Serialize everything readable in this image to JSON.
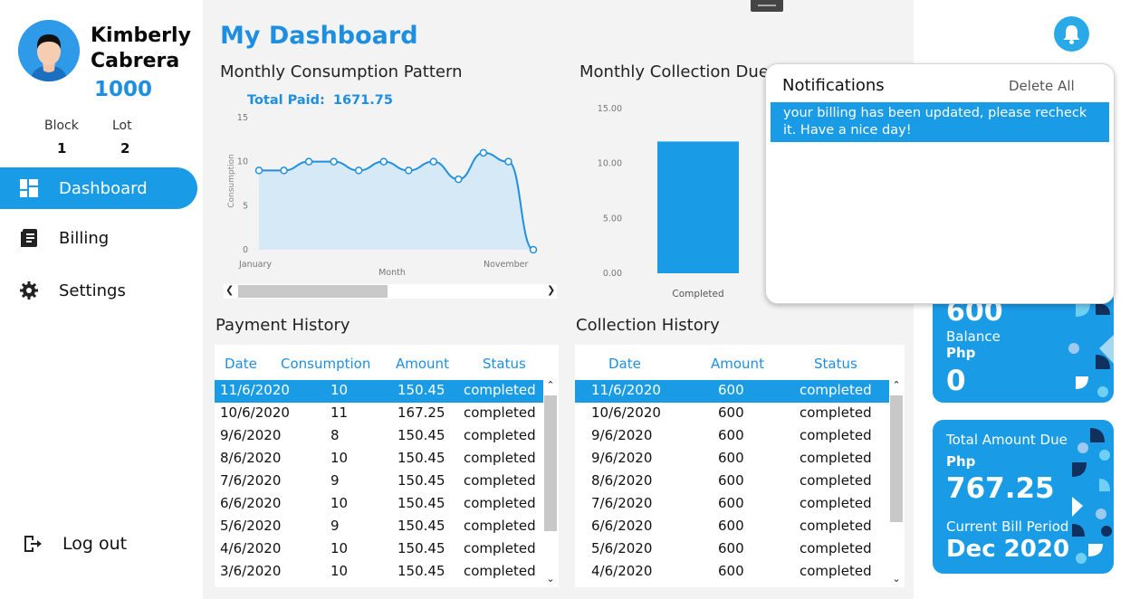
{
  "user": {
    "first_name": "Kimberly",
    "last_name": "Cabrera",
    "id": "1000",
    "block_label": "Block",
    "block_value": "1",
    "lot_label": "Lot",
    "lot_value": "2"
  },
  "nav": {
    "items": [
      {
        "label": "Dashboard",
        "icon": "dashboard-grid-icon",
        "active": true
      },
      {
        "label": "Billing",
        "icon": "billing-document-icon",
        "active": false
      },
      {
        "label": "Settings",
        "icon": "gear-icon",
        "active": false
      }
    ],
    "logout_label": "Log out"
  },
  "main": {
    "title": "My Dashboard",
    "consumption_title": "Monthly Consumption Pattern",
    "collection_title": "Monthly Collection Due",
    "total_paid_label": "Total Paid:",
    "total_paid_value": "1671.75",
    "payment_history_title": "Payment History",
    "collection_history_title": "Collection History"
  },
  "payment_history": {
    "columns": [
      "Date",
      "Consumption",
      "Amount",
      "Status"
    ],
    "rows": [
      [
        "11/6/2020",
        "10",
        "150.45",
        "completed"
      ],
      [
        "10/6/2020",
        "11",
        "167.25",
        "completed"
      ],
      [
        "9/6/2020",
        "8",
        "150.45",
        "completed"
      ],
      [
        "8/6/2020",
        "10",
        "150.45",
        "completed"
      ],
      [
        "7/6/2020",
        "9",
        "150.45",
        "completed"
      ],
      [
        "6/6/2020",
        "10",
        "150.45",
        "completed"
      ],
      [
        "5/6/2020",
        "9",
        "150.45",
        "completed"
      ],
      [
        "4/6/2020",
        "10",
        "150.45",
        "completed"
      ],
      [
        "3/6/2020",
        "10",
        "150.45",
        "completed"
      ]
    ]
  },
  "collection_history": {
    "columns": [
      "Date",
      "Amount",
      "Status"
    ],
    "rows": [
      [
        "11/6/2020",
        "600",
        "completed"
      ],
      [
        "10/6/2020",
        "600",
        "completed"
      ],
      [
        "9/6/2020",
        "600",
        "completed"
      ],
      [
        "9/6/2020",
        "600",
        "completed"
      ],
      [
        "8/6/2020",
        "600",
        "completed"
      ],
      [
        "7/6/2020",
        "600",
        "completed"
      ],
      [
        "6/6/2020",
        "600",
        "completed"
      ],
      [
        "5/6/2020",
        "600",
        "completed"
      ],
      [
        "4/6/2020",
        "600",
        "completed"
      ]
    ]
  },
  "cards": {
    "balance_amount_partial": "600",
    "balance_label": "Balance",
    "balance_currency": "Php",
    "balance_value": "0",
    "due_label": "Total Amount Due",
    "due_currency": "Php",
    "due_value": "767.25",
    "period_label": "Current Bill Period",
    "period_value": "Dec 2020"
  },
  "notifications": {
    "title": "Notifications",
    "delete_all_label": "Delete All",
    "items": [
      "your billing has been updated, please recheck it. Have a nice day!"
    ]
  },
  "colors": {
    "accent": "#1a9be6",
    "title_blue": "#1e8fe0",
    "chart_fill": "#d6e9f7",
    "chart_line": "#1f8fe0"
  },
  "chart_data": [
    {
      "type": "area",
      "title": "Monthly Consumption Pattern",
      "xlabel": "Month",
      "ylabel": "Consumption",
      "x_tick_labels": [
        "January",
        "November"
      ],
      "y_ticks": [
        "15",
        "10",
        "5",
        "0"
      ],
      "ylim": [
        0,
        15
      ],
      "series": [
        {
          "values": [
            9,
            9,
            10,
            10,
            9,
            10,
            9,
            10,
            8,
            11,
            10,
            0
          ]
        }
      ],
      "grid": false,
      "horizontal_scrollbar": true
    },
    {
      "type": "bar",
      "title": "Monthly Collection Due",
      "categories": [
        "Completed"
      ],
      "values": [
        12
      ],
      "y_ticks": [
        "15.00",
        "10.00",
        "5.00",
        "0.00"
      ],
      "ylim": [
        0,
        15
      ],
      "grid": false
    }
  ]
}
